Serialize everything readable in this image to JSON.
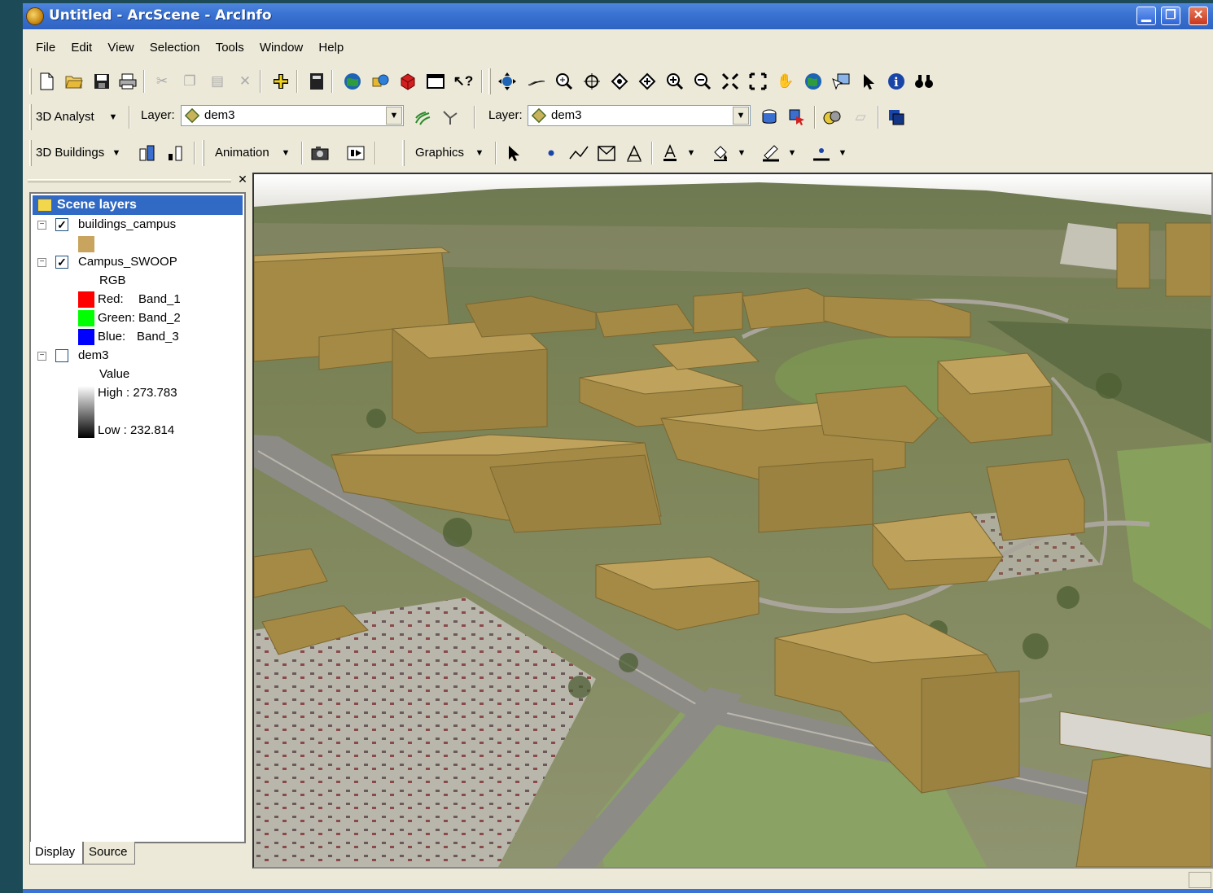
{
  "window": {
    "title": "Untitled - ArcScene - ArcInfo",
    "controls": {
      "minimize": "▁",
      "maximize": "❐",
      "close": "✕"
    }
  },
  "menu": [
    "File",
    "Edit",
    "View",
    "Selection",
    "Tools",
    "Window",
    "Help"
  ],
  "toolbar_standard": {
    "icons": [
      "new-document-icon",
      "open-folder-icon",
      "save-icon",
      "print-icon",
      "cut-icon",
      "copy-icon",
      "paste-icon",
      "delete-icon",
      "add-data-icon",
      "scene-properties-icon",
      "arctoolbox-icon",
      "catalog-icon",
      "3d-shapes-icon",
      "window-icon",
      "whats-this-icon"
    ]
  },
  "toolbar_navigation": {
    "icons": [
      "navigate-icon",
      "fly-icon",
      "zoom-target-icon",
      "center-target-icon",
      "zoom-to-target-icon",
      "set-observer-icon",
      "zoom-in-icon",
      "zoom-out-icon",
      "full-extent-icon",
      "extent-icon",
      "pan-icon",
      "globe-icon",
      "select-features-icon",
      "select-elements-icon",
      "identify-icon",
      "find-icon"
    ]
  },
  "toolbar_3d_analyst": {
    "label": "3D Analyst",
    "layer_label": "Layer:",
    "layer_value": "dem3",
    "layer2_label": "Layer:",
    "layer2_value": "dem3"
  },
  "toolbar_3d_buildings": {
    "label": "3D Buildings"
  },
  "toolbar_animation": {
    "label": "Animation"
  },
  "toolbar_graphics": {
    "label": "Graphics"
  },
  "toc": {
    "header": "Scene layers",
    "layers": [
      {
        "name": "buildings_campus",
        "checked": true,
        "swatch_color": "#c8a45f"
      },
      {
        "name": "Campus_SWOOP",
        "checked": true,
        "legend_title": "RGB",
        "bands": [
          {
            "label": "Red:",
            "band": "Band_1",
            "color": "#ff0000"
          },
          {
            "label": "Green:",
            "band": "Band_2",
            "color": "#00ff00"
          },
          {
            "label": "Blue:",
            "band": "Band_3",
            "color": "#0000ff"
          }
        ]
      },
      {
        "name": "dem3",
        "checked": false,
        "legend_title": "Value",
        "high": "High : 273.783",
        "low": "Low : 232.814"
      }
    ],
    "tabs": [
      "Display",
      "Source"
    ]
  },
  "colors": {
    "title_bar": "#3a73d3",
    "toc_header": "#316ac5",
    "building": "#a48a45"
  }
}
